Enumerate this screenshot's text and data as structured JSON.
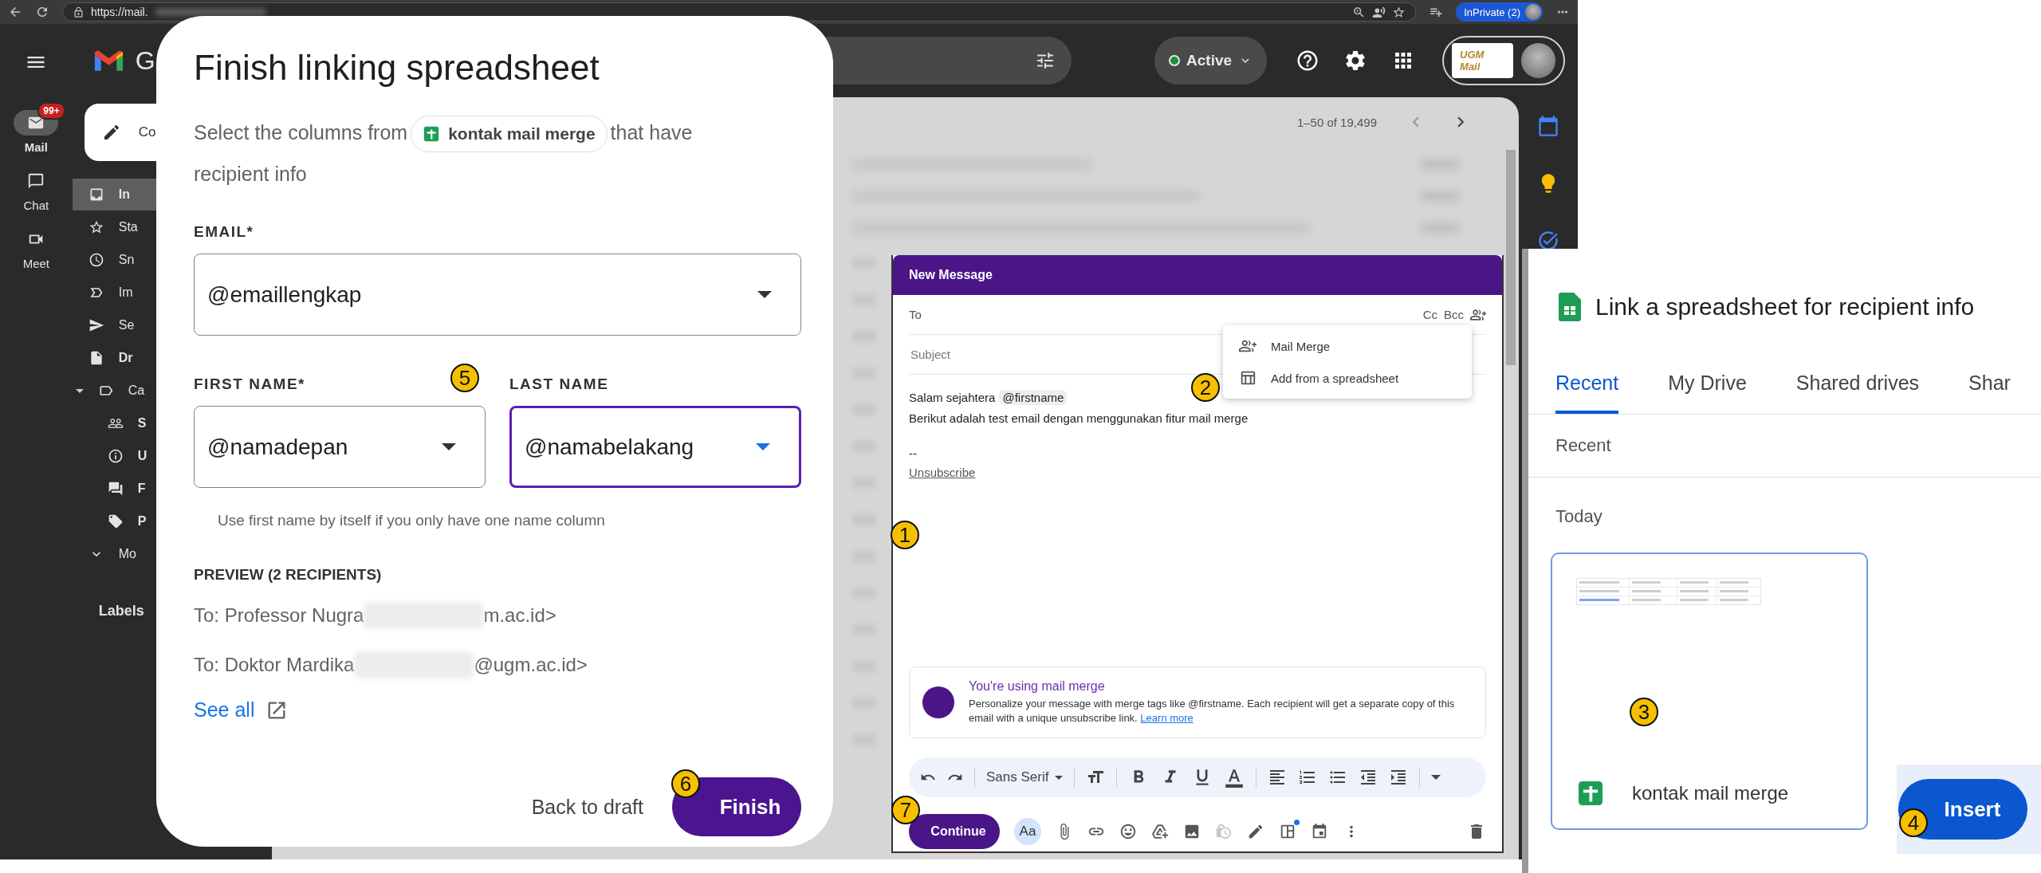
{
  "browser": {
    "url": "https://mail.",
    "private_badge": "InPrivate (2)"
  },
  "gmail": {
    "logo_text": "G",
    "compose_label": "Co",
    "rail": [
      {
        "label": "Mail",
        "badge": "99+",
        "selected": true
      },
      {
        "label": "Chat",
        "selected": false
      },
      {
        "label": "Meet",
        "selected": false
      }
    ],
    "nav": [
      {
        "label": "In",
        "selected": true,
        "unread": true
      },
      {
        "label": "Sta",
        "selected": false,
        "unread": false
      },
      {
        "label": "Sn",
        "selected": false,
        "unread": false
      },
      {
        "label": "Im",
        "selected": false,
        "unread": false
      },
      {
        "label": "Se",
        "selected": false,
        "unread": false
      },
      {
        "label": "Dr",
        "selected": false,
        "unread": true
      },
      {
        "label": "Ca",
        "selected": false,
        "unread": false,
        "expanded": true,
        "children": [
          {
            "label": "S",
            "selected": false,
            "unread": true
          },
          {
            "label": "U",
            "selected": false,
            "unread": true
          },
          {
            "label": "F",
            "selected": false,
            "unread": true
          },
          {
            "label": "P",
            "selected": false,
            "unread": true
          }
        ]
      },
      {
        "label": "Mo",
        "selected": false,
        "unread": false
      }
    ],
    "labels_heading": "Labels",
    "status": "Active",
    "account_logo": "UGM Mail",
    "count": "1–50 of 19,499"
  },
  "finish_dialog": {
    "title": "Finish linking spreadsheet",
    "intro_before": "Select the columns from",
    "sheet_chip": "kontak mail merge",
    "intro_after": "that have recipient info",
    "fields": [
      {
        "label": "EMAIL*",
        "value": "@emaillengkap",
        "focused": false
      },
      {
        "label": "FIRST NAME*",
        "value": "@namadepan",
        "focused": false
      },
      {
        "label": "LAST NAME",
        "value": "@namabelakang",
        "focused": true
      }
    ],
    "hint": "Use first name by itself if you only have one name column",
    "preview_heading": "PREVIEW (2 RECIPIENTS)",
    "preview": [
      {
        "before": "To: Professor Nugra",
        "after": "m.ac.id>"
      },
      {
        "before": "To: Doktor Mardika",
        "after": "@ugm.ac.id>"
      }
    ],
    "see_all": "See all",
    "back_button": "Back to draft",
    "finish_button": "Finish"
  },
  "compose": {
    "title": "New Message",
    "to_label": "To",
    "cc": "Cc",
    "bcc": "Bcc",
    "subject_placeholder": "Subject",
    "menu": [
      {
        "label": "Mail Merge"
      },
      {
        "label": "Add from a spreadsheet"
      }
    ],
    "greeting": "Salam sejahtera",
    "merge_tag": "@firstname",
    "body_line": "Berikut adalah test email dengan menggunakan fitur mail merge",
    "signature_dash": "--",
    "unsubscribe": "Unsubscribe",
    "notice": {
      "title": "You're using mail merge",
      "text": "Personalize your message with merge tags like @firstname. Each recipient will get a separate copy of this email with a unique unsubscribe link.",
      "link": "Learn more"
    },
    "font": "Sans Serif",
    "send_button": "Continue",
    "format_toggle": "Aa",
    "bottom_tools": [
      {
        "disabled": false,
        "dot": false
      },
      {
        "disabled": false,
        "dot": false
      },
      {
        "disabled": false,
        "dot": false
      },
      {
        "disabled": false,
        "dot": false
      },
      {
        "disabled": false,
        "dot": false
      },
      {
        "disabled": true,
        "dot": false
      },
      {
        "disabled": false,
        "dot": false
      },
      {
        "disabled": false,
        "dot": true
      },
      {
        "disabled": false,
        "dot": false
      },
      {
        "disabled": false,
        "dot": false
      }
    ]
  },
  "picker": {
    "title": "Link a spreadsheet for recipient info",
    "tabs": [
      {
        "label": "Recent",
        "selected": true
      },
      {
        "label": "My Drive",
        "selected": false
      },
      {
        "label": "Shared drives",
        "selected": false
      },
      {
        "label": "Shar",
        "selected": false
      }
    ],
    "section": "Recent",
    "group": "Today",
    "files": [
      {
        "name": "kontak mail merge",
        "selected": true
      }
    ],
    "insert_button": "Insert"
  },
  "annotations": [
    "1",
    "2",
    "3",
    "4",
    "5",
    "6",
    "7"
  ]
}
